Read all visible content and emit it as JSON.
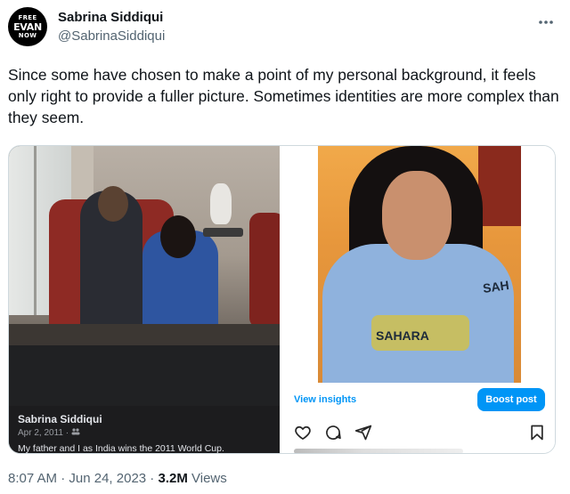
{
  "author": {
    "avatar_lines": [
      "FREE",
      "EVAN",
      "NOW"
    ],
    "name": "Sabrina Siddiqui",
    "handle": "@SabrinaSiddiqui"
  },
  "more_icon": "more-horizontal-icon",
  "tweet_text": "Since some have chosen to make a point of my personal background, it feels only right to provide a fuller picture. Sometimes identities are more complex than they seem.",
  "media": {
    "facebook_post": {
      "name": "Sabrina Siddiqui",
      "date": "Apr 2, 2011 · ",
      "audience_icon": "friends-icon",
      "caption": "My father and I as India wins the 2011 World Cup."
    },
    "instagram_post": {
      "shirt_text_1": "SAH",
      "shirt_text_2": "SAHARA",
      "view_insights": "View insights",
      "boost_button": "Boost post",
      "icons": [
        "heart-icon",
        "comment-icon",
        "share-icon",
        "bookmark-icon"
      ]
    }
  },
  "meta": {
    "time": "8:07 AM",
    "separator": " · ",
    "date": "Jun 24, 2023",
    "views_count": "3.2M",
    "views_label": " Views"
  },
  "colors": {
    "text_primary": "#0f1419",
    "text_secondary": "#536471",
    "instagram_blue": "#0095f6"
  }
}
